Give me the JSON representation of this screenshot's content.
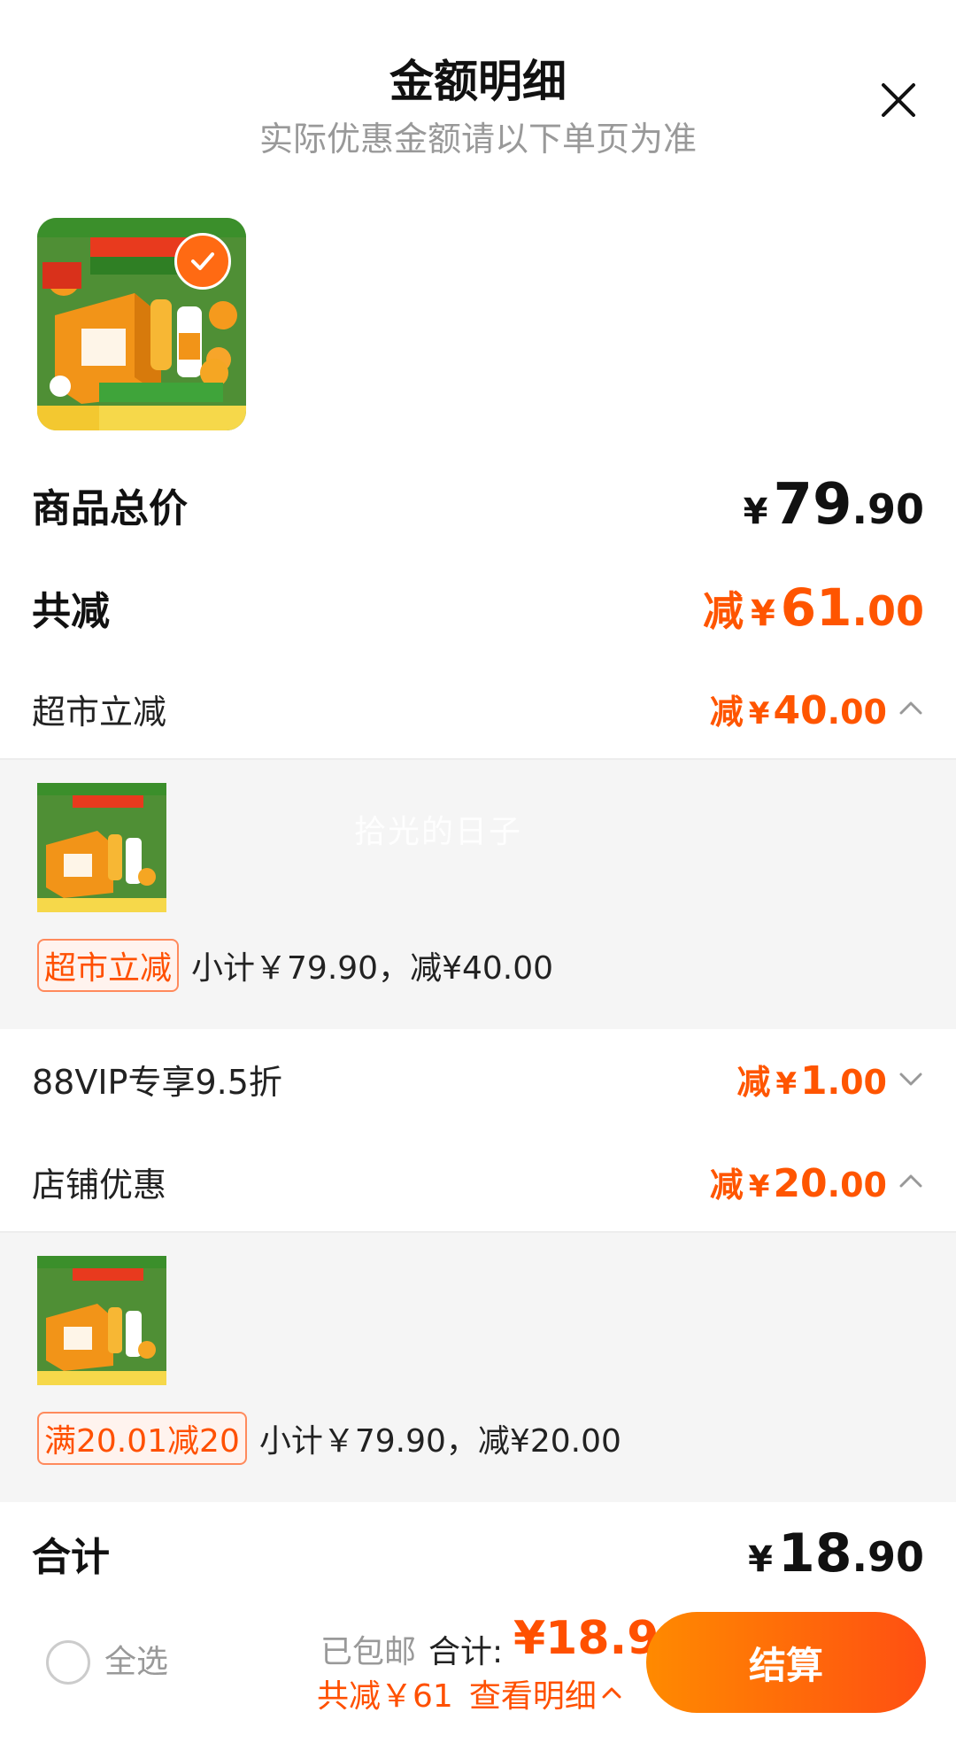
{
  "header": {
    "title": "金额明细",
    "subtitle": "实际优惠金额请以下单页为准"
  },
  "product": {
    "image_icon": "nfc-orange-juice-product-image",
    "selected": true
  },
  "rows": {
    "total_price": {
      "label": "商品总价",
      "currency": "¥",
      "int": "79",
      "dec": ".90"
    },
    "total_discount": {
      "label": "共减",
      "prefix": "减",
      "currency": "¥",
      "int": "61",
      "dec": ".00"
    },
    "supermarket": {
      "label": "超市立减",
      "prefix": "减",
      "currency": "¥",
      "int": "40",
      "dec": ".00",
      "expanded": true
    },
    "vip": {
      "label": "88VIP专享9.5折",
      "prefix": "减",
      "currency": "¥",
      "int": "1",
      "dec": ".00",
      "expanded": false
    },
    "store": {
      "label": "店铺优惠",
      "prefix": "减",
      "currency": "¥",
      "int": "20",
      "dec": ".00",
      "expanded": true
    },
    "grand_total": {
      "label": "合计",
      "currency": "¥",
      "int": "18",
      "dec": ".90"
    }
  },
  "panels": {
    "supermarket": {
      "tag": "超市立减",
      "text": "小计￥79.90，减¥40.00"
    },
    "store": {
      "tag": "满20.01减20",
      "text": "小计￥79.90，减¥20.00"
    }
  },
  "watermark": "拾光的日子",
  "bottom_bar": {
    "select_all": "全选",
    "shipping": "已包邮",
    "total_label": "合计:",
    "total_value": "¥18.9",
    "summary": "共减￥61",
    "detail_link": "查看明细",
    "checkout": "结算"
  },
  "colors": {
    "accent": "#ff5500",
    "panel_bg": "#f5f5f5",
    "button_start": "#ff8a00",
    "button_end": "#ff4f12"
  }
}
